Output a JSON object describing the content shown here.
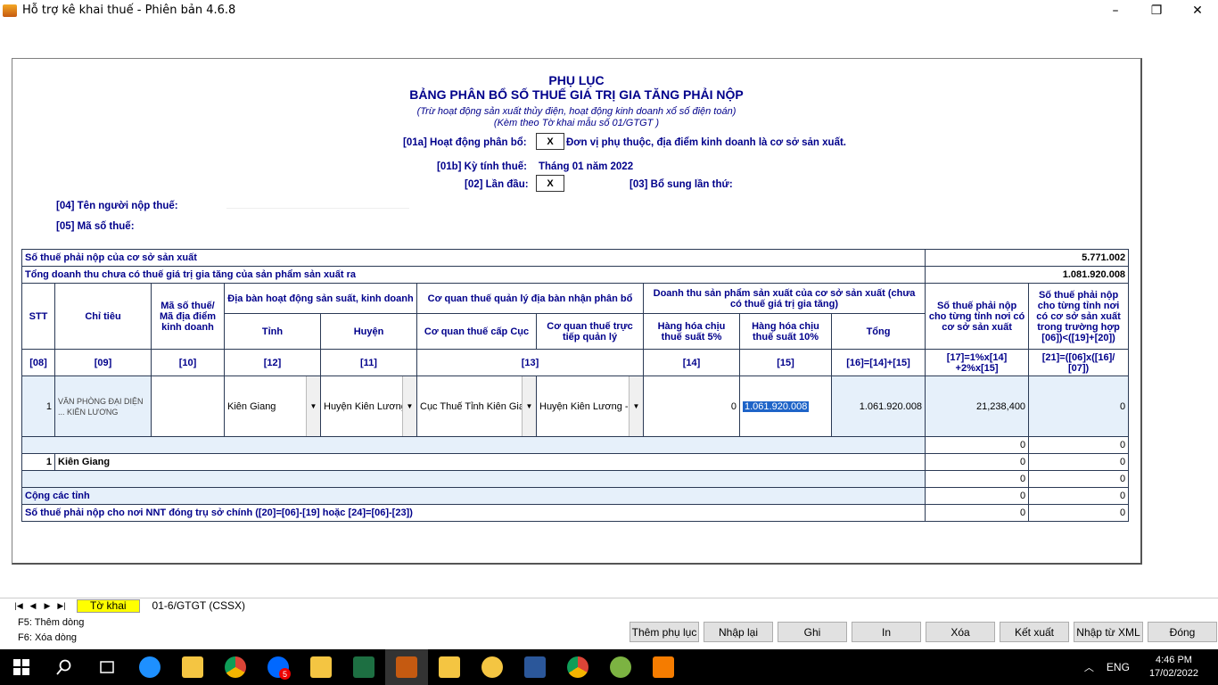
{
  "window": {
    "title": "Hỗ trợ kê khai thuế - Phiên bản 4.6.8",
    "minimize": "–",
    "restore": "❐",
    "close": "✕"
  },
  "form": {
    "title1": "PHỤ LỤC",
    "title2": "BẢNG PHÂN BỔ SỐ THUẾ GIÁ TRỊ GIA TĂNG PHẢI NỘP",
    "subtitle1": "(Trừ hoạt động sản xuất thủy điện, hoạt động kinh doanh xổ số điện toán)",
    "subtitle2": "(Kèm theo Tờ khai mẫu số 01/GTGT )",
    "f01a_label": "[01a] Hoạt động phân bổ:",
    "f01a_value": "X",
    "f01a_desc": "Đơn vị phụ thuộc, địa điểm kinh doanh là cơ sở sản xuất.",
    "f01b_label": "[01b] Kỳ tính thuế:",
    "f01b_value": "Tháng 01 năm 2022",
    "f02_label": "[02] Lần đầu:",
    "f02_value": "X",
    "f03_label": "[03] Bổ sung lần thứ:",
    "f04_label": "[04] Tên người nộp thuế:",
    "f05_label": "[05] Mã số thuế:"
  },
  "table": {
    "row_tax_label": "Số thuế phải nộp của cơ sở sản xuất",
    "row_tax_value": "5.771.002",
    "row_revenue_label": "Tổng doanh thu chưa có thuế giá trị gia tăng của sản phẩm sản xuất ra",
    "row_revenue_value": "1.081.920.008",
    "h_stt": "STT",
    "h_chitieu": "Chỉ tiêu",
    "h_mst": "Mã số thuế/ Mã địa điểm kinh doanh",
    "h_diaban": "Địa bàn hoạt động sản suất, kinh doanh",
    "h_tinh": "Tỉnh",
    "h_huyen": "Huyện",
    "h_coquan": "Cơ quan thuế quản lý địa bàn nhận phân bổ",
    "h_cuc": "Cơ quan thuế cấp Cục",
    "h_tructiep": "Cơ quan thuế trực tiếp quản lý",
    "h_doanhthu": "Doanh thu sản phẩm sản xuất của cơ sở sản xuất (chưa có thuế giá trị gia tăng)",
    "h_5": "Hàng hóa chịu thuế suất 5%",
    "h_10": "Hàng hóa chịu thuế suất 10%",
    "h_tong": "Tổng",
    "h_17": "Số thuế phải nộp cho từng tỉnh nơi có cơ sở sản xuất",
    "h_21": "Số thuế phải nộp cho từng tỉnh nơi có cơ sở sản xuất trong trường hợp [06])<([19]+[20])",
    "c08": "[08]",
    "c09": "[09]",
    "c10": "[10]",
    "c12": "[12]",
    "c11": "[11]",
    "c13": "[13]",
    "c14": "[14]",
    "c15": "[15]",
    "c16": "[16]=[14]+[15]",
    "c17": "[17]=1%x[14] +2%x[15]",
    "c21": "[21]=([06]x([16]/ [07])",
    "r1_stt": "1",
    "r1_name": "VĂN PHÒNG ĐẠI DIỆN ... KIÊN LƯƠNG",
    "r1_tinh": "Kiên Giang",
    "r1_huyen": "Huyện Kiên Lương",
    "r1_cuc": "Cục Thuế Tỉnh Kiên Giang",
    "r1_tructiep": "Huyện Kiên Lương -",
    "r1_v14": "0",
    "r1_v15": "1.061.920.008",
    "r1_v16": "1.061.920.008",
    "r1_v17": "21,238,400",
    "r1_v21": "0",
    "blank1_v17": "0",
    "blank1_v21": "0",
    "sum_stt": "1",
    "sum_name": "Kiên Giang",
    "sum_v17": "0",
    "sum_v21": "0",
    "blank2_v17": "0",
    "blank2_v21": "0",
    "cong_label": "Cộng các tỉnh",
    "cong_v17": "0",
    "cong_v21": "0",
    "nnt_label": "Số thuế phải nộp cho nơi NNT đóng trụ sở chính ([20]=[06]-[19] hoặc [24]=[06]-[23])",
    "nnt_v17": "0",
    "nnt_v21": "0"
  },
  "tabs": {
    "first": "|◀",
    "prev": "◀",
    "next": "▶",
    "last": "▶|",
    "tab1": "Tờ khai",
    "tab2": "01-6/GTGT (CSSX)"
  },
  "hints": {
    "f5": "F5: Thêm dòng",
    "f6": "F6: Xóa dòng"
  },
  "buttons": {
    "them_phu_luc": "Thêm phụ lục",
    "nhap_lai": "Nhập lại",
    "ghi": "Ghi",
    "in": "In",
    "xoa": "Xóa",
    "ket_xuat": "Kết xuất",
    "nhap_tu_xml": "Nhập từ XML",
    "dong": "Đóng"
  },
  "taskbar": {
    "lang": "ENG",
    "time": "4:46 PM",
    "date": "17/02/2022",
    "zalo_badge": "5"
  }
}
